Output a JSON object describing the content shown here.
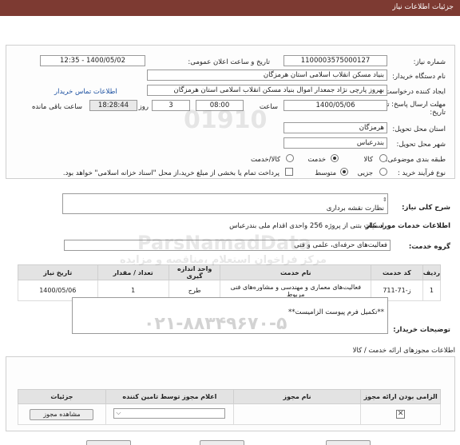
{
  "header": {
    "title": "جزئیات اطلاعات نیاز"
  },
  "fields": {
    "need_number_label": "شماره نیاز:",
    "need_number": "1100003575000127",
    "announce_label": "تاریخ و ساعت اعلان عمومی:",
    "announce_value": "1400/05/02 - 12:35",
    "buyer_org_label": "نام دستگاه خریدار:",
    "buyer_org": "بنیاد مسکن انقلاب اسلامی استان هرمزگان",
    "creator_label": "ایجاد کننده درخواست:",
    "creator": "بهروز  پارچی نژاد جمعدار اموال بنیاد مسکن انقلاب اسلامی استان هرمزگان",
    "contact_link": "اطلاعات تماس خریدار",
    "deadline_label": "مهلت ارسال پاسخ: تا تاریخ:",
    "deadline_date": "1400/05/06",
    "time_label": "ساعت",
    "deadline_time": "08:00",
    "days_value": "3",
    "days_label": "روز و",
    "remaining_time": "18:28:44",
    "remaining_label": "ساعت باقی مانده",
    "province_label": "استان محل تحویل:",
    "province": "هرمزگان",
    "city_label": "شهر محل تحویل:",
    "city": "بندرعباس",
    "category_label": "طبقه بندی موضوعی:",
    "category_options": [
      "کالا",
      "خدمت",
      "کالا/خدمت"
    ],
    "process_label": "نوع فرآیند خرید :",
    "process_options": [
      "جزیی",
      "متوسط"
    ],
    "payment_note": "پرداخت تمام یا بخشی از مبلغ خرید،از محل \"اسناد خزانه اسلامی\" خواهد بود."
  },
  "need_desc": {
    "label": "شرح کلی نیاز:",
    "line1": "نظارت نقشه برداری",
    "line2": "اسکلت بتنی   از پروژه 256 واحدی اقدام ملی بندرعباس"
  },
  "services": {
    "section_title": "اطلاعات خدمات مورد نیاز",
    "group_label": "گروه خدمت:",
    "group_value": "فعالیت‌های حرفه‌ای، علمی و فنی",
    "headers": [
      "ردیف",
      "کد خدمت",
      "نام خدمت",
      "واحد اندازه گیری",
      "تعداد / مقدار",
      "تاریخ نیاز"
    ],
    "rows": [
      [
        "1",
        "ز-71-711",
        "فعالیت‌های معماری و مهندسی و مشاوره‌های فنی مربوط",
        "طرح",
        "1",
        "1400/05/06"
      ]
    ]
  },
  "buyer_notes": {
    "label": "توضیحات خریدار:",
    "text": "**تکمیل فرم پیوست الزامیست**"
  },
  "permits": {
    "section_title": "اطلاعات مجوزهای ارائه خدمت / کالا",
    "headers": [
      "الزامی بودن ارائه مجوز",
      "نام مجوز",
      "اعلام مجوز توسط تامین کننده",
      "جزئیات"
    ],
    "view_button": "مشاهده مجوز"
  },
  "watermark": {
    "code": "01910",
    "site": "ParsNamadData",
    "line": "مرکز فراخوان استعلام ،مناقصه و مزایده",
    "phone": "۰۲۱-۸۸۳۴۹۶۷۰-۵"
  }
}
